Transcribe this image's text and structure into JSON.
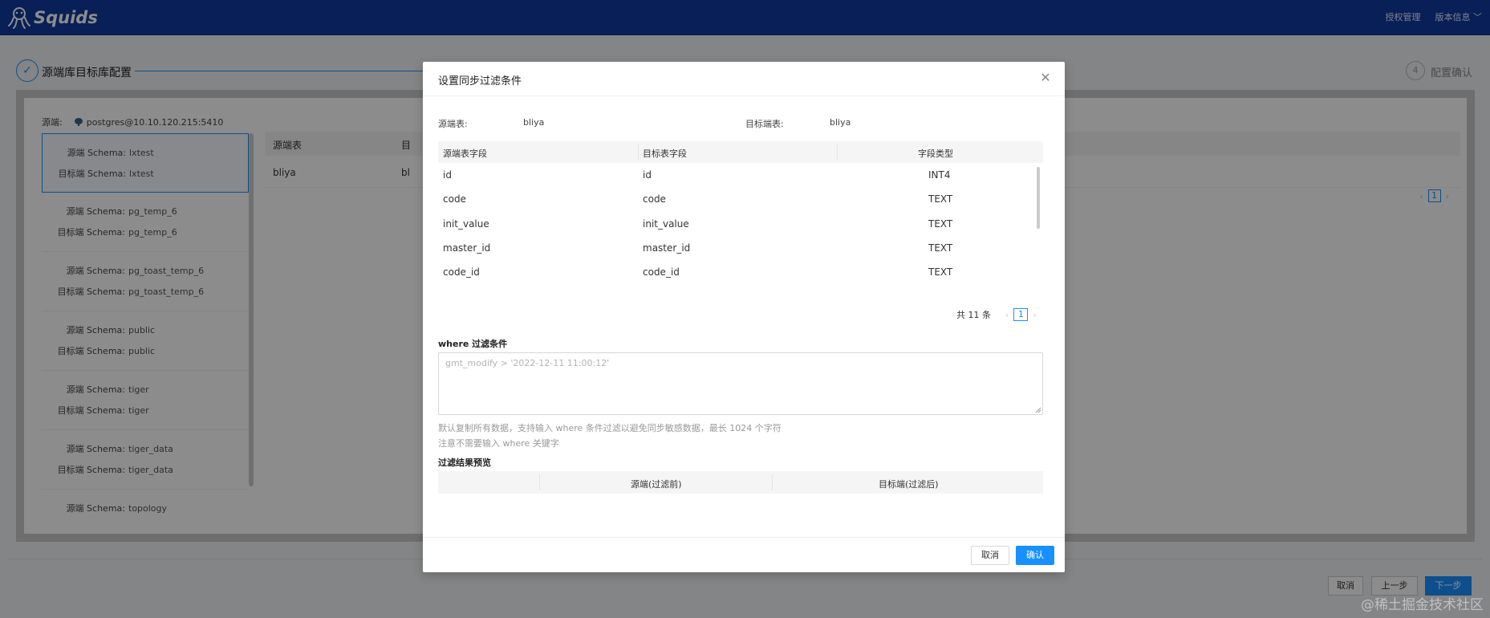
{
  "app": {
    "name": "Squids"
  },
  "topnav": {
    "license": "授权管理",
    "version": "版本信息"
  },
  "steps": {
    "step1_label": "源端库目标库配置",
    "step4_number": "4",
    "step4_label": "配置确认"
  },
  "background": {
    "source_label": "源端:",
    "source_value": "postgres@10.10.120.215:5410",
    "schemas": [
      {
        "src_key": "源端 Schema:",
        "src": "lxtest",
        "dst_key": "目标端 Schema:",
        "dst": "lxtest"
      },
      {
        "src_key": "源端 Schema:",
        "src": "pg_temp_6",
        "dst_key": "目标端 Schema:",
        "dst": "pg_temp_6"
      },
      {
        "src_key": "源端 Schema:",
        "src": "pg_toast_temp_6",
        "dst_key": "目标端 Schema:",
        "dst": "pg_toast_temp_6"
      },
      {
        "src_key": "源端 Schema:",
        "src": "public",
        "dst_key": "目标端 Schema:",
        "dst": "public"
      },
      {
        "src_key": "源端 Schema:",
        "src": "tiger",
        "dst_key": "目标端 Schema:",
        "dst": "tiger"
      },
      {
        "src_key": "源端 Schema:",
        "src": "tiger_data",
        "dst_key": "目标端 Schema:",
        "dst": "tiger_data"
      },
      {
        "src_key": "源端 Schema:",
        "src": "topology",
        "dst_key": "",
        "dst": ""
      }
    ],
    "table_header_src": "源端表",
    "table_header_dst": "目",
    "row_src": "bliya",
    "row_dst": "bl",
    "page": "1",
    "buttons": {
      "cancel": "取消",
      "prev": "上一步",
      "next": "下一步"
    }
  },
  "modal": {
    "title": "设置同步过滤条件",
    "src_table_label": "源端表:",
    "src_table_value": "bliya",
    "dst_table_label": "目标端表:",
    "dst_table_value": "bliya",
    "columns": [
      "源端表字段",
      "目标表字段",
      "字段类型"
    ],
    "rows": [
      {
        "src": "id",
        "dst": "id",
        "type": "INT4"
      },
      {
        "src": "code",
        "dst": "code",
        "type": "TEXT"
      },
      {
        "src": "init_value",
        "dst": "init_value",
        "type": "TEXT"
      },
      {
        "src": "master_id",
        "dst": "master_id",
        "type": "TEXT"
      },
      {
        "src": "code_id",
        "dst": "code_id",
        "type": "TEXT"
      }
    ],
    "total": "共 11 条",
    "page": "1",
    "where_label": "where 过滤条件",
    "where_placeholder": "gmt_modify > '2022-12-11 11:00:12'",
    "hint1": "默认复制所有数据，支持输入 where 条件过滤以避免同步敏感数据，最长 1024 个字符",
    "hint2": "注意不需要输入 where 关键字",
    "preview_label": "过滤结果预览",
    "preview_cols": [
      "源端(过滤前)",
      "目标端(过滤后)"
    ],
    "cancel": "取消",
    "confirm": "确认"
  },
  "watermark": "@稀土掘金技术社区",
  "colors": {
    "topbar": "#0f3a9e",
    "primary": "#1890ff"
  }
}
